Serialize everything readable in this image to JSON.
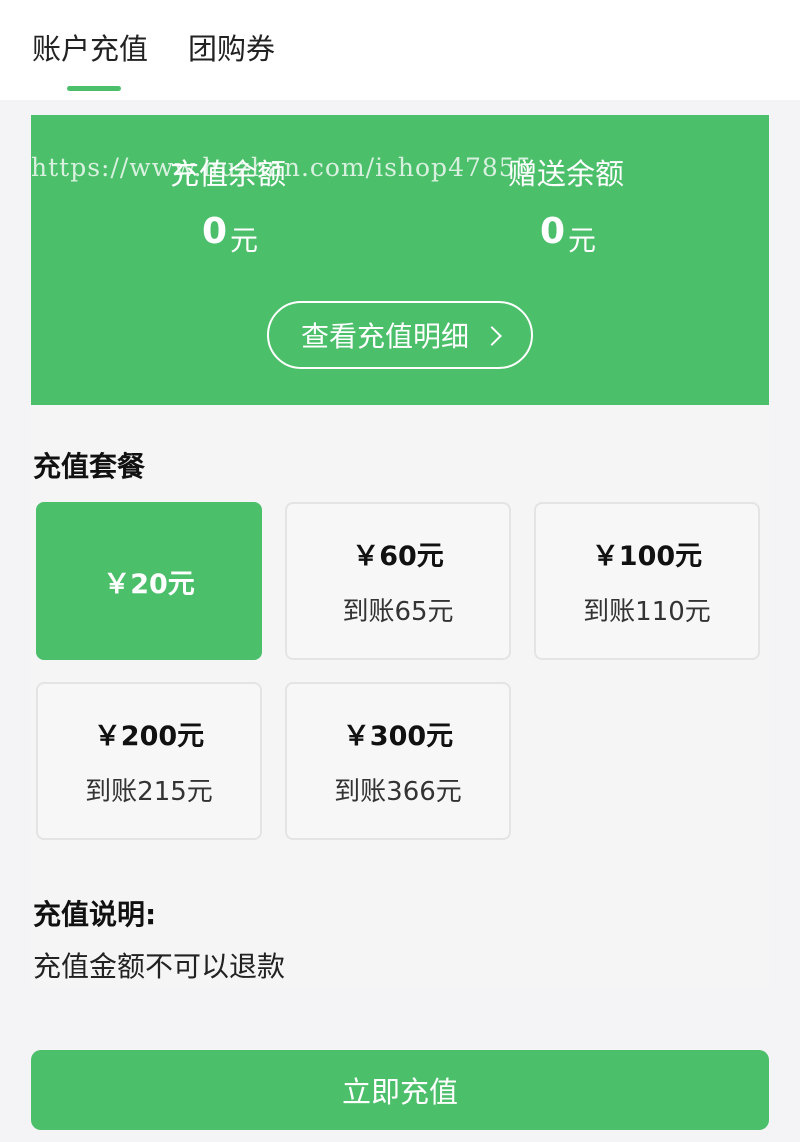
{
  "tabs": [
    {
      "label": "账户充值",
      "active": true
    },
    {
      "label": "团购券",
      "active": false
    }
  ],
  "balance": {
    "recharge_label": "充值余额",
    "recharge_amount": "0",
    "recharge_unit": "元",
    "gift_label": "赠送余额",
    "gift_amount": "0",
    "gift_unit": "元",
    "watermark": "https://www.huzhan.com/ishop47855",
    "detail_button": "查看充值明细",
    "detail_icon": "chevron-right-icon"
  },
  "packages": {
    "title": "充值套餐",
    "items": [
      {
        "price": "￥20元",
        "bonus": "",
        "selected": true
      },
      {
        "price": "￥60元",
        "bonus": "到账65元",
        "selected": false
      },
      {
        "price": "￥100元",
        "bonus": "到账110元",
        "selected": false
      },
      {
        "price": "￥200元",
        "bonus": "到账215元",
        "selected": false
      },
      {
        "price": "￥300元",
        "bonus": "到账366元",
        "selected": false
      }
    ]
  },
  "description": {
    "title": "充值说明:",
    "text": "充值金额不可以退款"
  },
  "submit_label": "立即充值",
  "colors": {
    "accent": "#4cbf6b",
    "background": "#f4f4f6"
  }
}
